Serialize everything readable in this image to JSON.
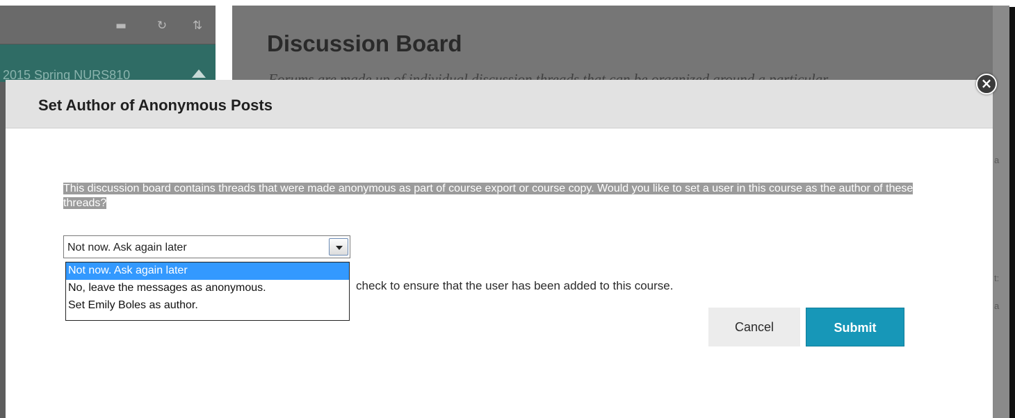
{
  "background": {
    "sidebar": {
      "toolbar_icons": [
        "folder-icon",
        "refresh-icon",
        "sort-icon"
      ],
      "course_name": "2015 Spring NURS810"
    },
    "page": {
      "title": "Discussion Board",
      "description": "Forums are made up of individual discussion threads that can be organized around a particular"
    },
    "edge_fragments": [
      "a",
      "t:",
      "a"
    ]
  },
  "modal": {
    "title": "Set Author of Anonymous Posts",
    "close_icon": "close-icon",
    "message": "This discussion board contains threads that were made anonymous as part of course export or course copy. Would you like to set a user in this course as the author of these threads?",
    "select": {
      "selected_value": "Not now. Ask again later",
      "options": [
        "Not now. Ask again later",
        "No, leave the messages as anonymous.",
        "Set Emily Boles as author."
      ],
      "highlighted_index": 0
    },
    "hint": "check to ensure that the user has been added to this course.",
    "buttons": {
      "cancel": "Cancel",
      "submit": "Submit"
    }
  },
  "colors": {
    "submit": "#1797b8",
    "course_bar": "#2f6c65",
    "option_highlight": "#3399ff",
    "overlay": "#767676"
  }
}
